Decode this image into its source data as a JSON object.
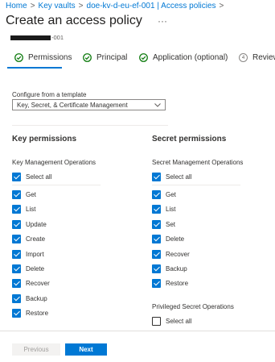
{
  "breadcrumb": [
    "Home",
    "Key vaults",
    "doe-kv-d-eu-ef-001 | Access policies"
  ],
  "title": "Create an access policy",
  "more_label": "···",
  "subtitle_suffix": "-001",
  "steps": [
    {
      "label": "Permissions",
      "state": "complete"
    },
    {
      "label": "Principal",
      "state": "complete"
    },
    {
      "label": "Application (optional)",
      "state": "complete"
    },
    {
      "label": "Review",
      "number": "4",
      "state": "pending"
    }
  ],
  "template": {
    "label": "Configure from a template",
    "selected": "Key, Secret, & Certificate Management"
  },
  "key_permissions": {
    "title": "Key permissions",
    "group_label": "Key Management Operations",
    "select_all": "Select all",
    "items": [
      "Get",
      "List",
      "Update",
      "Create",
      "Import",
      "Delete",
      "Recover",
      "Backup",
      "Restore"
    ]
  },
  "secret_permissions": {
    "title": "Secret permissions",
    "group_label": "Secret Management Operations",
    "select_all": "Select all",
    "items": [
      "Get",
      "List",
      "Set",
      "Delete",
      "Recover",
      "Backup",
      "Restore"
    ],
    "privileged_label": "Privileged Secret Operations",
    "privileged_select_all": "Select all"
  },
  "buttons": {
    "previous": "Previous",
    "next": "Next"
  },
  "colors": {
    "accent": "#0078d4",
    "success": "#107c10"
  }
}
